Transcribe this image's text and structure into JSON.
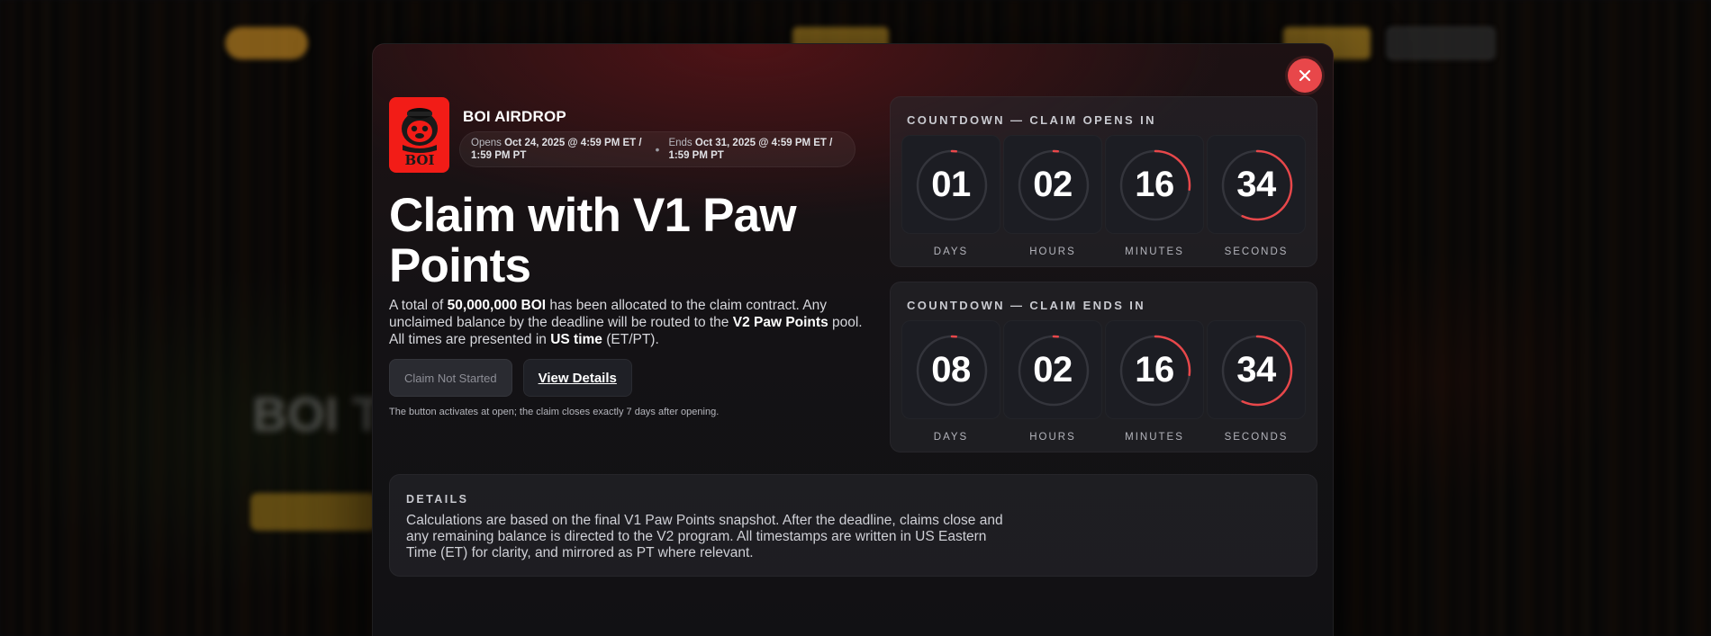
{
  "background": {
    "hero_text": "BOI T"
  },
  "modal": {
    "brand": {
      "title": "BOI AIRDROP",
      "logo_text": "BOI",
      "opens_prefix": "Opens ",
      "opens_date": "Oct 24, 2025 @ 4:59 PM ET /",
      "opens_pt": "1:59 PM PT",
      "separator": "•",
      "ends_prefix": "Ends ",
      "ends_date": "Oct 31, 2025 @ 4:59 PM ET /",
      "ends_pt": "1:59 PM PT"
    },
    "heading": "Claim with V1 Paw Points",
    "description": {
      "p1": "A total of ",
      "amount": "50,000,000 BOI",
      "p2": " has been allocated to the claim contract. Any unclaimed balance by the deadline will be routed to the ",
      "pool": "V2 Paw Points",
      "p3": " pool. All times are presented in ",
      "timezone": "US time",
      "p4": " (ET/PT)."
    },
    "buttons": {
      "claim_label": "Claim Not Started",
      "details_label": "View Details"
    },
    "note": "The button activates at open; the claim closes exactly 7 days after opening.",
    "countdown_opens": {
      "title": "COUNTDOWN — CLAIM OPENS IN",
      "units": [
        {
          "value": "01",
          "label": "DAYS",
          "progress": 0.02
        },
        {
          "value": "02",
          "label": "HOURS",
          "progress": 0.02
        },
        {
          "value": "16",
          "label": "MINUTES",
          "progress": 0.27
        },
        {
          "value": "34",
          "label": "SECONDS",
          "progress": 0.57
        }
      ]
    },
    "countdown_ends": {
      "title": "COUNTDOWN — CLAIM ENDS IN",
      "units": [
        {
          "value": "08",
          "label": "DAYS",
          "progress": 0.02
        },
        {
          "value": "02",
          "label": "HOURS",
          "progress": 0.02
        },
        {
          "value": "16",
          "label": "MINUTES",
          "progress": 0.27
        },
        {
          "value": "34",
          "label": "SECONDS",
          "progress": 0.57
        }
      ]
    },
    "details": {
      "title": "DETAILS",
      "body": "Calculations are based on the final V1 Paw Points snapshot. After the deadline, claims close and any remaining balance is directed to the V2 program. All timestamps are written in US Eastern Time (ET) for clarity, and mirrored as PT where relevant."
    }
  },
  "colors": {
    "accent": "#e8474a",
    "ring_track": "#34353c",
    "logo_red": "#f21c17"
  }
}
